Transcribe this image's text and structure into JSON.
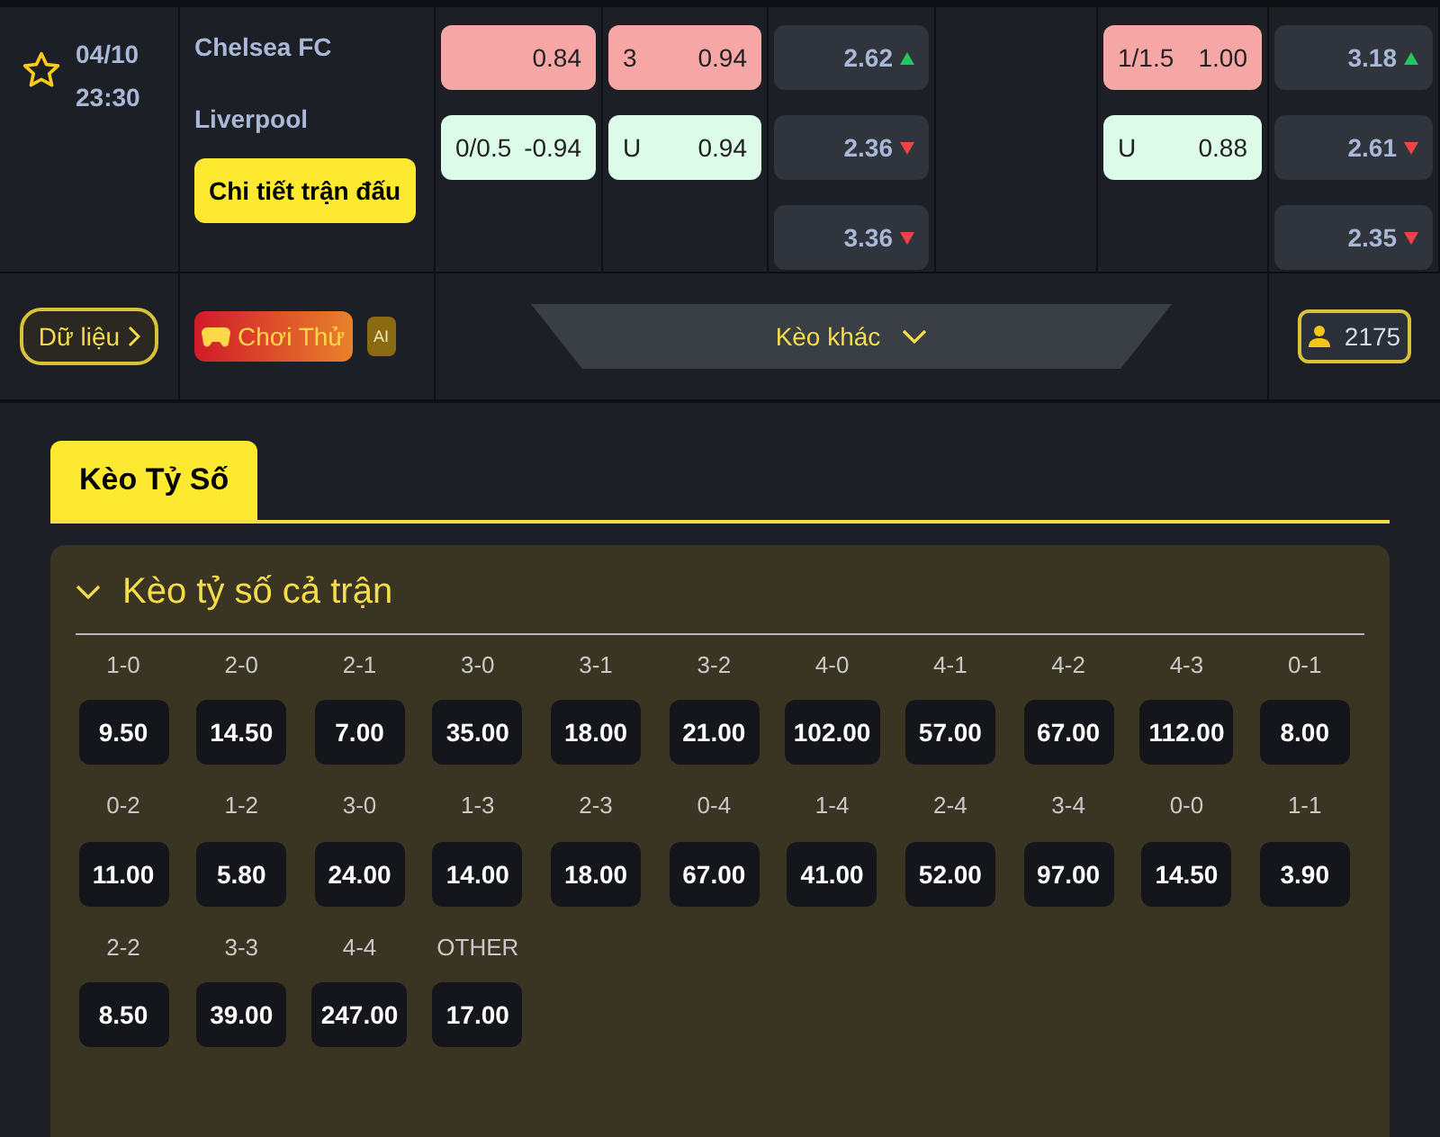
{
  "match": {
    "favorite": false,
    "date": "04/10",
    "time": "23:30",
    "home": "Chelsea FC",
    "away": "Liverpool",
    "details_button": "Chi tiết trận đấu"
  },
  "odds_columns": [
    {
      "cells": [
        {
          "kind": "home",
          "value": "0.84"
        },
        {
          "kind": "away",
          "label": "0/0.5",
          "value": "-0.94"
        }
      ]
    },
    {
      "cells": [
        {
          "kind": "home",
          "label": "3",
          "value": "0.94"
        },
        {
          "kind": "away",
          "label": "U",
          "value": "0.94"
        }
      ]
    },
    {
      "cells": [
        {
          "kind": "plain",
          "value": "2.62",
          "rising": true
        },
        {
          "kind": "plain",
          "value": "2.36",
          "rising": false
        },
        {
          "kind": "plain",
          "value": "3.36",
          "rising": false
        }
      ]
    },
    {
      "kind": "blank"
    },
    {
      "cells": [
        {
          "kind": "home",
          "label": "1/1.5",
          "value": "1.00"
        },
        {
          "kind": "away",
          "label": "U",
          "value": "0.88"
        }
      ]
    },
    {
      "cells": [
        {
          "kind": "plain",
          "value": "3.18",
          "rising": true
        },
        {
          "kind": "plain",
          "value": "2.61",
          "rising": false
        },
        {
          "kind": "plain",
          "value": "2.35",
          "rising": false
        }
      ]
    }
  ],
  "actions": {
    "data_button": "Dữ liệu",
    "play_button": "Chơi Thử",
    "ai_badge": "AI",
    "more_button": "Kèo khác",
    "viewers": "2175"
  },
  "tabs": [
    {
      "label": "Kèo Tỷ Số",
      "selected": true
    }
  ],
  "score_panel": {
    "title": "Kèo tỷ số cả trận",
    "expanded": true,
    "scores": [
      {
        "score": "1-0",
        "odds": "9.50"
      },
      {
        "score": "2-0",
        "odds": "14.50"
      },
      {
        "score": "2-1",
        "odds": "7.00"
      },
      {
        "score": "3-0",
        "odds": "35.00"
      },
      {
        "score": "3-1",
        "odds": "18.00"
      },
      {
        "score": "3-2",
        "odds": "21.00"
      },
      {
        "score": "4-0",
        "odds": "102.00"
      },
      {
        "score": "4-1",
        "odds": "57.00"
      },
      {
        "score": "4-2",
        "odds": "67.00"
      },
      {
        "score": "4-3",
        "odds": "112.00"
      },
      {
        "score": "0-1",
        "odds": "8.00"
      },
      {
        "score": "0-2",
        "odds": "11.00"
      },
      {
        "score": "1-2",
        "odds": "5.80"
      },
      {
        "score": "3-0",
        "odds": "24.00"
      },
      {
        "score": "1-3",
        "odds": "14.00"
      },
      {
        "score": "2-3",
        "odds": "18.00"
      },
      {
        "score": "0-4",
        "odds": "67.00"
      },
      {
        "score": "1-4",
        "odds": "41.00"
      },
      {
        "score": "2-4",
        "odds": "52.00"
      },
      {
        "score": "3-4",
        "odds": "97.00"
      },
      {
        "score": "0-0",
        "odds": "14.50"
      },
      {
        "score": "1-1",
        "odds": "3.90"
      },
      {
        "score": "2-2",
        "odds": "8.50"
      },
      {
        "score": "3-3",
        "odds": "39.00"
      },
      {
        "score": "4-4",
        "odds": "247.00"
      },
      {
        "score": "OTHER",
        "odds": "17.00"
      }
    ]
  }
}
